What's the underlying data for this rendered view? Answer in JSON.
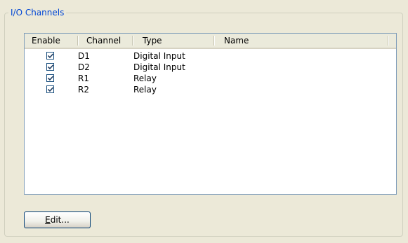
{
  "groupbox": {
    "title": "I/O Channels"
  },
  "table": {
    "columns": [
      {
        "key": "enable",
        "label": "Enable"
      },
      {
        "key": "channel",
        "label": "Channel"
      },
      {
        "key": "type",
        "label": "Type"
      },
      {
        "key": "name",
        "label": "Name"
      }
    ],
    "rows": [
      {
        "enabled": true,
        "channel": "D1",
        "type": "Digital Input",
        "name": ""
      },
      {
        "enabled": true,
        "channel": "D2",
        "type": "Digital Input",
        "name": ""
      },
      {
        "enabled": true,
        "channel": "R1",
        "type": "Relay",
        "name": ""
      },
      {
        "enabled": true,
        "channel": "R2",
        "type": "Relay",
        "name": ""
      }
    ]
  },
  "buttons": {
    "edit_mnemonic": "E",
    "edit_rest": "dit..."
  },
  "colors": {
    "group_title": "#0046D5",
    "window_bg": "#ECE9D8",
    "list_border": "#7F9DB9"
  }
}
